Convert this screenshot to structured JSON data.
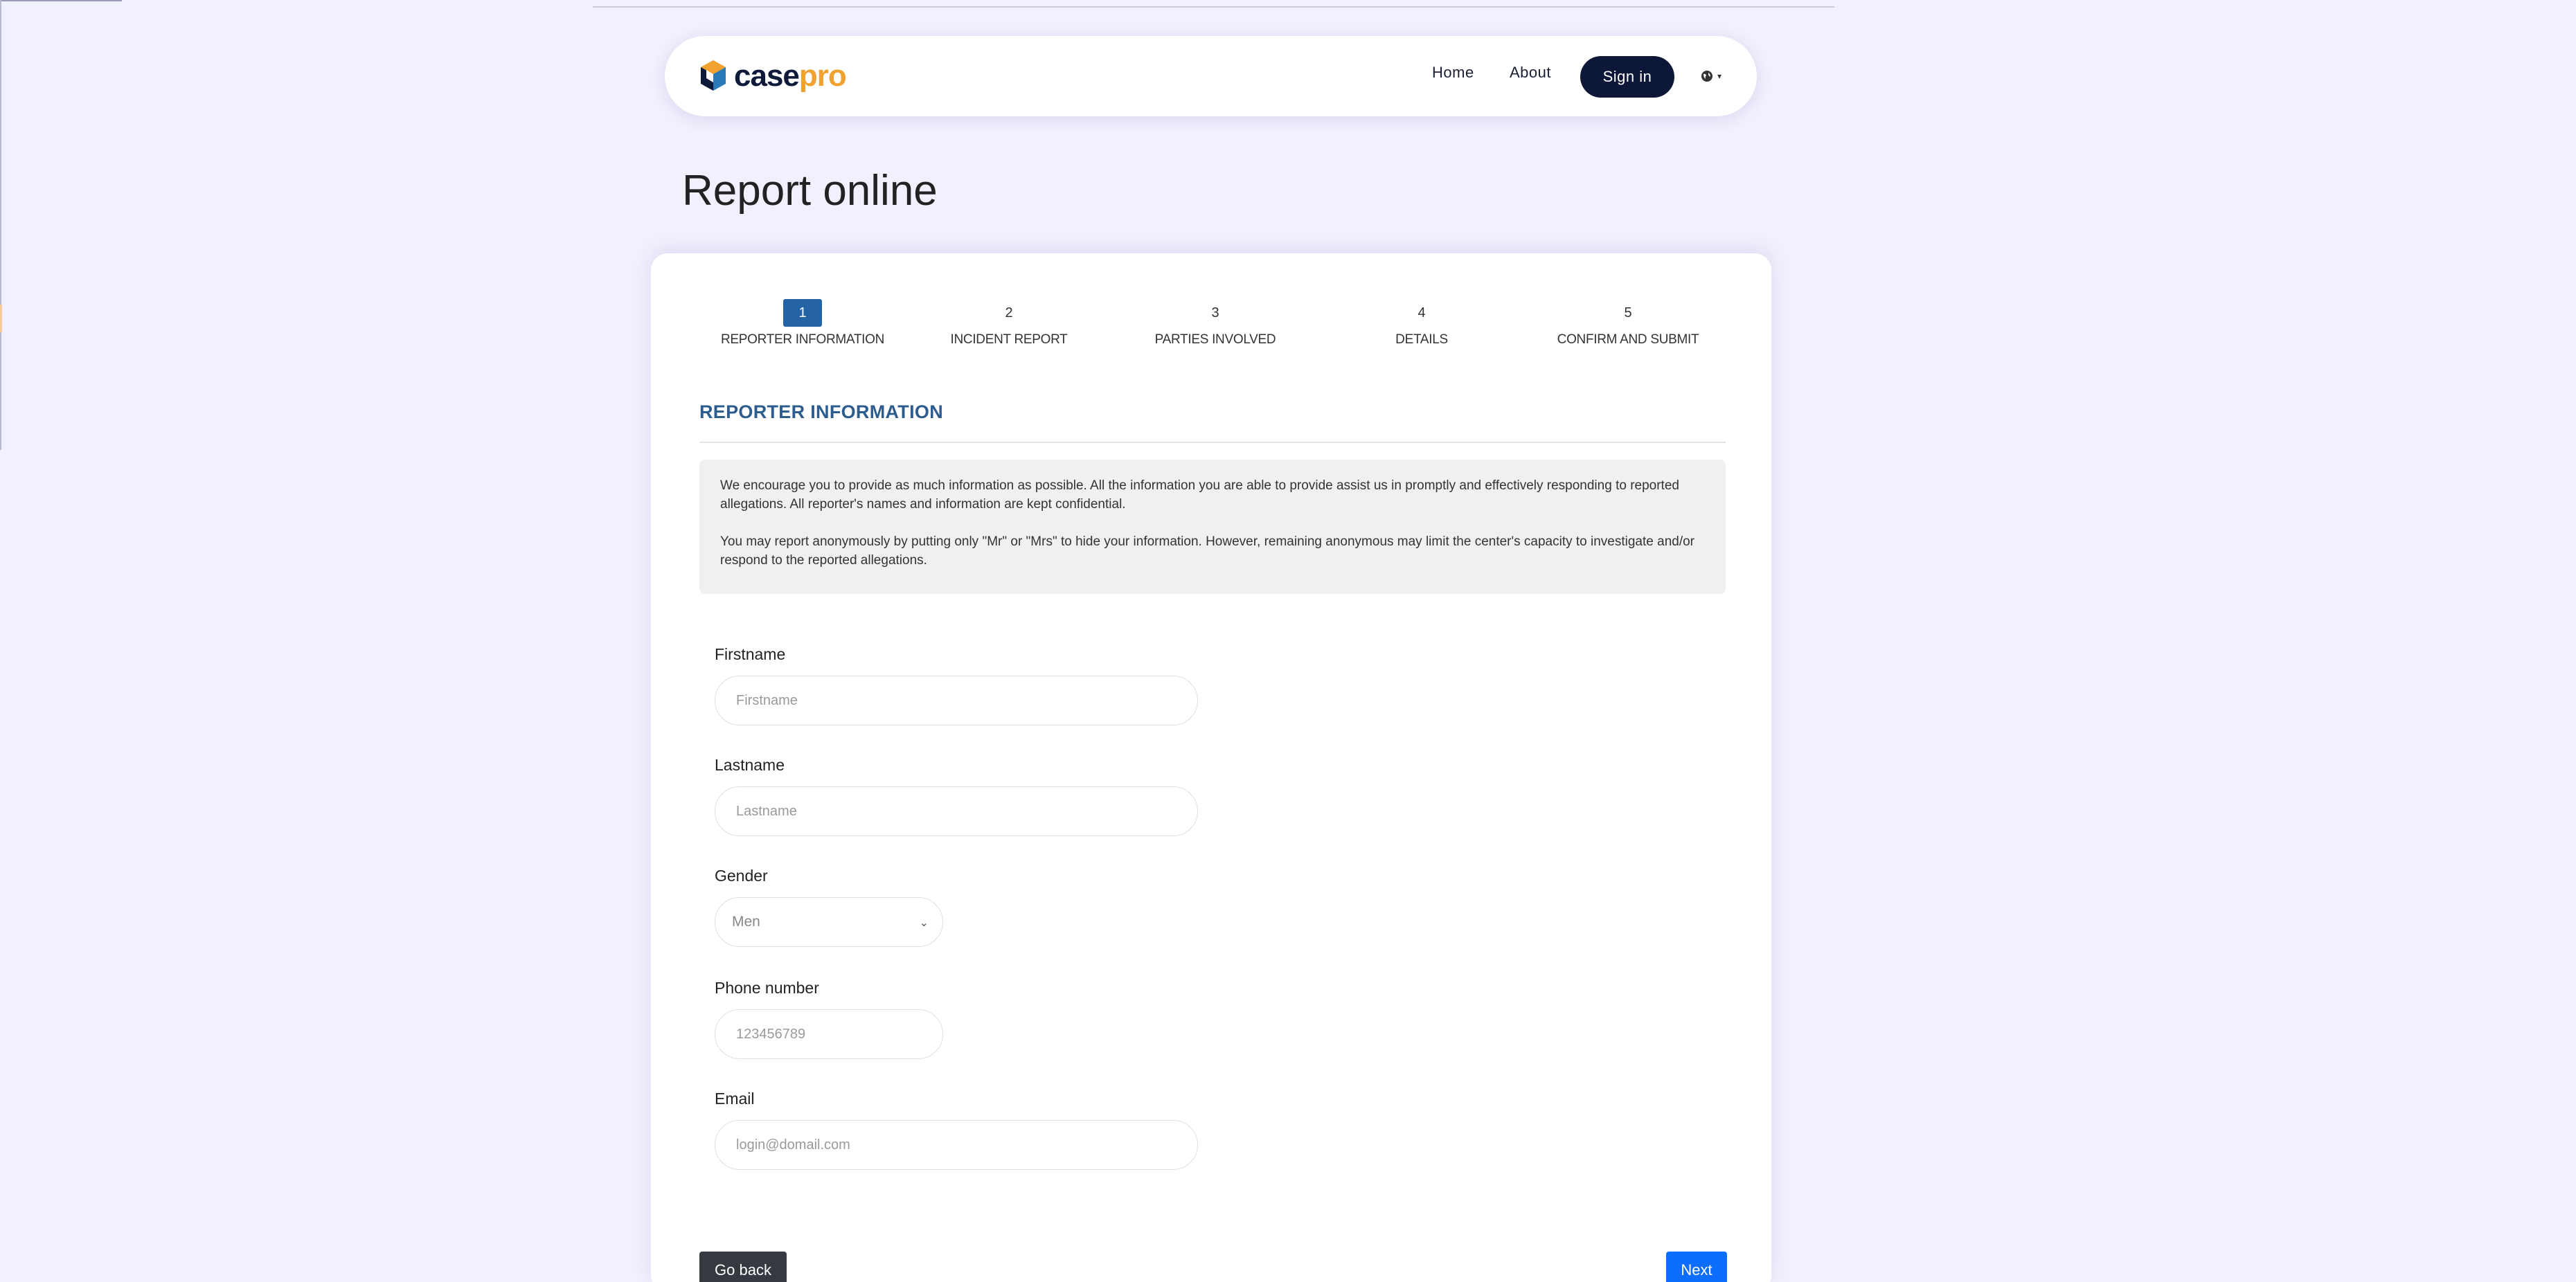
{
  "header": {
    "logo_case": "case",
    "logo_pro": "pro",
    "nav": {
      "home": "Home",
      "about": "About",
      "sign_in": "Sign in"
    },
    "language_icon": "globe-icon"
  },
  "page": {
    "title": "Report online"
  },
  "steps": [
    {
      "number": "1",
      "label": "REPORTER INFORMATION",
      "active": true
    },
    {
      "number": "2",
      "label": "INCIDENT REPORT",
      "active": false
    },
    {
      "number": "3",
      "label": "PARTIES INVOLVED",
      "active": false
    },
    {
      "number": "4",
      "label": "DETAILS",
      "active": false
    },
    {
      "number": "5",
      "label": "CONFIRM AND SUBMIT",
      "active": false
    }
  ],
  "section": {
    "title": "REPORTER INFORMATION",
    "info_paragraph_1": "We encourage you to provide as much information as possible. All the information you are able to provide assist us in promptly and effectively responding to reported allegations. All reporter's names and information are kept confidential.",
    "info_paragraph_2": "You may report anonymously by putting only \"Mr\" or \"Mrs\" to hide your information. However, remaining anonymous may limit the center's capacity to investigate and/or respond to the reported allegations."
  },
  "form": {
    "firstname": {
      "label": "Firstname",
      "placeholder": "Firstname",
      "value": ""
    },
    "lastname": {
      "label": "Lastname",
      "placeholder": "Lastname",
      "value": ""
    },
    "gender": {
      "label": "Gender",
      "selected": "Men"
    },
    "phone": {
      "label": "Phone number",
      "placeholder": "123456789",
      "value": ""
    },
    "email": {
      "label": "Email",
      "placeholder": "login@domail.com",
      "value": ""
    }
  },
  "actions": {
    "back": "Go back",
    "next": "Next"
  },
  "colors": {
    "background": "#f0f0fe",
    "navy": "#0d1838",
    "brand_orange": "#f0a12e",
    "step_active": "#2464a4",
    "section_title": "#2d5d8e",
    "primary": "#0d6efd"
  }
}
